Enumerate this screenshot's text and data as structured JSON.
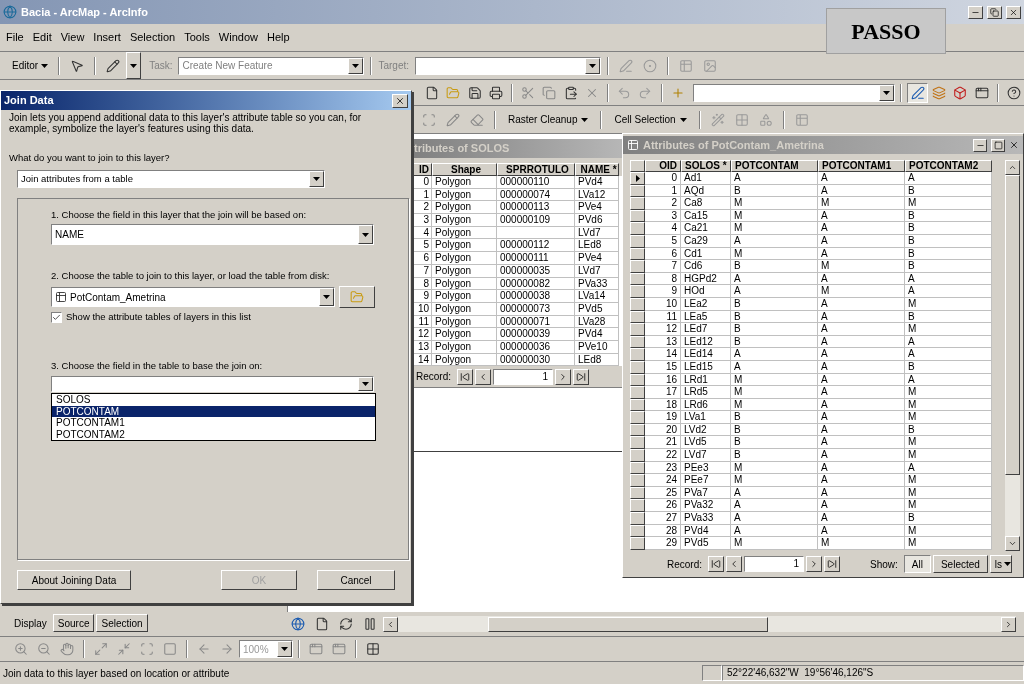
{
  "window": {
    "title": "Bacia - ArcMap - ArcInfo"
  },
  "menu": [
    "File",
    "Edit",
    "View",
    "Insert",
    "Selection",
    "Tools",
    "Window",
    "Help"
  ],
  "overlay_label": "PASSO",
  "editor_toolbar": {
    "editor": "Editor",
    "task_label": "Task:",
    "task_value": "Create New Feature",
    "target_label": "Target:"
  },
  "raster_toolbar": {
    "menus": [
      "Raster Cleanup",
      "Cell Selection"
    ]
  },
  "join_dialog": {
    "title": "Join Data",
    "intro": "Join lets you append additional data to this layer's attribute table so you can, for example, symbolize the layer's features using this data.",
    "question": "What do you want to join to this layer?",
    "join_type": "Join attributes from a table",
    "step1": "1.  Choose the field in this layer that the join will be based on:",
    "step1_value": "NAME",
    "step2": "2.  Choose the table to join to this layer, or load the table from disk:",
    "step2_value": "PotContam_Ametrina",
    "show_tables": {
      "label": "Show the attribute tables of layers in this list",
      "checked": true
    },
    "step3": "3.  Choose the field in the table to base the join on:",
    "field_options": [
      {
        "label": "SOLOS",
        "selected": false
      },
      {
        "label": "POTCONTAM",
        "selected": true
      },
      {
        "label": "POTCONTAM1",
        "selected": false
      },
      {
        "label": "POTCONTAM2",
        "selected": false
      }
    ],
    "buttons": [
      {
        "label": "About Joining Data",
        "disabled": false
      },
      {
        "label": "OK",
        "disabled": true
      },
      {
        "label": "Cancel",
        "disabled": false
      }
    ]
  },
  "solos_table": {
    "title": "tributes of SOLOS",
    "columns": [
      "ID",
      "Shape",
      "SPRROTULO",
      "NAME *"
    ],
    "rows": [
      [
        "0",
        "Polygon",
        "000000110",
        "PVd4"
      ],
      [
        "1",
        "Polygon",
        "000000074",
        "LVa12"
      ],
      [
        "2",
        "Polygon",
        "000000113",
        "PVe4"
      ],
      [
        "3",
        "Polygon",
        "000000109",
        "PVd6"
      ],
      [
        "4",
        "Polygon",
        "",
        "LVd7"
      ],
      [
        "5",
        "Polygon",
        "000000112",
        "LEd8"
      ],
      [
        "6",
        "Polygon",
        "000000111",
        "PVe4"
      ],
      [
        "7",
        "Polygon",
        "000000035",
        "LVd7"
      ],
      [
        "8",
        "Polygon",
        "000000082",
        "PVa33"
      ],
      [
        "9",
        "Polygon",
        "000000038",
        "LVa14"
      ],
      [
        "10",
        "Polygon",
        "000000073",
        "PVd5"
      ],
      [
        "11",
        "Polygon",
        "000000071",
        "LVa28"
      ],
      [
        "12",
        "Polygon",
        "000000039",
        "PVd4"
      ],
      [
        "13",
        "Polygon",
        "000000036",
        "PVe10"
      ],
      [
        "14",
        "Polygon",
        "000000030",
        "LEd8"
      ]
    ],
    "record_label": "Record:",
    "record_value": "1"
  },
  "potcontam_table": {
    "title": "Attributes of PotContam_Ametrina",
    "columns": [
      "OID",
      "SOLOS *",
      "POTCONTAM",
      "POTCONTAM1",
      "POTCONTAM2"
    ],
    "rows": [
      {
        "cells": [
          "0",
          "Ad1",
          "A",
          "A",
          "A"
        ],
        "current": true
      },
      {
        "cells": [
          "1",
          "AQd",
          "B",
          "A",
          "B"
        ],
        "current": false
      },
      {
        "cells": [
          "2",
          "Ca8",
          "M",
          "M",
          "M"
        ],
        "current": false
      },
      {
        "cells": [
          "3",
          "Ca15",
          "M",
          "A",
          "B"
        ],
        "current": false
      },
      {
        "cells": [
          "4",
          "Ca21",
          "M",
          "A",
          "B"
        ],
        "current": false
      },
      {
        "cells": [
          "5",
          "Ca29",
          "A",
          "A",
          "B"
        ],
        "current": false
      },
      {
        "cells": [
          "6",
          "Cd1",
          "M",
          "A",
          "B"
        ],
        "current": false
      },
      {
        "cells": [
          "7",
          "Cd6",
          "B",
          "M",
          "B"
        ],
        "current": false
      },
      {
        "cells": [
          "8",
          "HGPd2",
          "A",
          "A",
          "A"
        ],
        "current": false
      },
      {
        "cells": [
          "9",
          "HOd",
          "A",
          "M",
          "A"
        ],
        "current": false
      },
      {
        "cells": [
          "10",
          "LEa2",
          "B",
          "A",
          "M"
        ],
        "current": false
      },
      {
        "cells": [
          "11",
          "LEa5",
          "B",
          "A",
          "B"
        ],
        "current": false
      },
      {
        "cells": [
          "12",
          "LEd7",
          "B",
          "A",
          "M"
        ],
        "current": false
      },
      {
        "cells": [
          "13",
          "LEd12",
          "B",
          "A",
          "A"
        ],
        "current": false
      },
      {
        "cells": [
          "14",
          "LEd14",
          "A",
          "A",
          "A"
        ],
        "current": false
      },
      {
        "cells": [
          "15",
          "LEd15",
          "A",
          "A",
          "B"
        ],
        "current": false
      },
      {
        "cells": [
          "16",
          "LRd1",
          "M",
          "A",
          "A"
        ],
        "current": false
      },
      {
        "cells": [
          "17",
          "LRd5",
          "M",
          "A",
          "M"
        ],
        "current": false
      },
      {
        "cells": [
          "18",
          "LRd6",
          "M",
          "A",
          "M"
        ],
        "current": false
      },
      {
        "cells": [
          "19",
          "LVa1",
          "B",
          "A",
          "M"
        ],
        "current": false
      },
      {
        "cells": [
          "20",
          "LVd2",
          "B",
          "A",
          "B"
        ],
        "current": false
      },
      {
        "cells": [
          "21",
          "LVd5",
          "B",
          "A",
          "M"
        ],
        "current": false
      },
      {
        "cells": [
          "22",
          "LVd7",
          "B",
          "A",
          "M"
        ],
        "current": false
      },
      {
        "cells": [
          "23",
          "PEe3",
          "M",
          "A",
          "A"
        ],
        "current": false
      },
      {
        "cells": [
          "24",
          "PEe7",
          "M",
          "A",
          "M"
        ],
        "current": false
      },
      {
        "cells": [
          "25",
          "PVa7",
          "A",
          "A",
          "M"
        ],
        "current": false
      },
      {
        "cells": [
          "26",
          "PVa32",
          "A",
          "A",
          "M"
        ],
        "current": false
      },
      {
        "cells": [
          "27",
          "PVa33",
          "A",
          "A",
          "B"
        ],
        "current": false
      },
      {
        "cells": [
          "28",
          "PVd4",
          "A",
          "A",
          "M"
        ],
        "current": false
      },
      {
        "cells": [
          "29",
          "PVd5",
          "M",
          "M",
          "M"
        ],
        "current": false
      }
    ],
    "record_label": "Record:",
    "record_value": "1",
    "show_label": "Show:",
    "show_options": [
      {
        "label": "All",
        "selected": true
      },
      {
        "label": "Selected",
        "selected": false
      }
    ],
    "options_button": "ls"
  },
  "toc_tabs": [
    {
      "label": "Display",
      "selected": true
    },
    {
      "label": "Source",
      "selected": false
    },
    {
      "label": "Selection",
      "selected": false
    }
  ],
  "zoom_value": "100%",
  "status_bar": {
    "message": "Join data to this layer based on location or attribute",
    "coordinates": "52°22'46,632\"W  19°56'46,126\"S"
  }
}
